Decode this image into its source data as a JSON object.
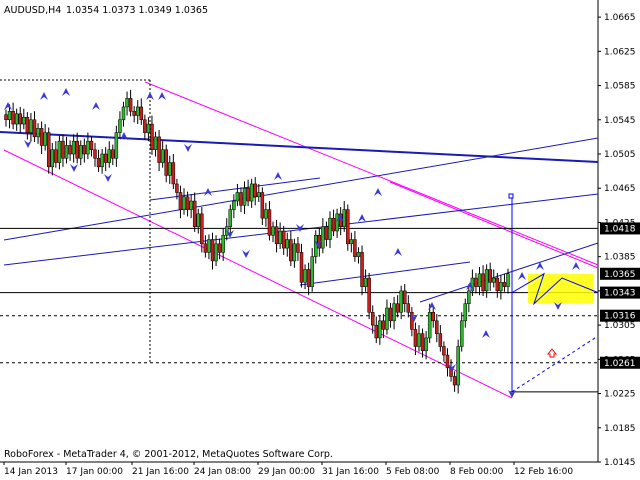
{
  "header": {
    "symbol": "AUDUSD,H4",
    "ohlc": "1.0354 1.0373 1.0349 1.0365"
  },
  "footer": {
    "copyright": "RoboForex - MetaTrader 4, © 2001-2012, MetaQuotes Software Corp."
  },
  "colors": {
    "bull_candle": "#2db52d",
    "bear_candle": "#c81e1e",
    "trend_channel": "#ff00ff",
    "trend_line": "#1a1ab4",
    "fractal_arrow": "#3a3ad0",
    "level_line": "#000000",
    "price_tag_bg": "#000000",
    "price_tag_fg": "#ffffff",
    "forecast_zone": "#ffff00",
    "forecast_arrow": "#ff0000"
  },
  "chart_data": {
    "type": "candlestick",
    "title": "AUDUSD,H4",
    "ylim": [
      1.0145,
      1.0685
    ],
    "price_ticks": [
      "1.0665",
      "1.0625",
      "1.0585",
      "1.0545",
      "1.0505",
      "1.0465",
      "1.0425",
      "1.0385",
      "1.0345",
      "1.0305",
      "1.0265",
      "1.0225",
      "1.0185",
      "1.0145"
    ],
    "time_ticks": [
      "14 Jan 2013",
      "17 Jan 00:00",
      "21 Jan 16:00",
      "24 Jan 08:00",
      "29 Jan 00:00",
      "31 Jan 16:00",
      "5 Feb 08:00",
      "8 Feb 00:00",
      "12 Feb 16:00"
    ],
    "price_tags": [
      {
        "label": "1.0418",
        "highlight": true
      },
      {
        "label": "1.0365",
        "highlight": true
      },
      {
        "label": "1.0343",
        "highlight": true
      },
      {
        "label": "1.0316",
        "highlight": true
      },
      {
        "label": "1.0261",
        "highlight": true
      }
    ],
    "horizontal_levels": [
      1.0418,
      1.0343,
      1.0316,
      1.0261,
      1.0227
    ],
    "closes": [
      1.0545,
      1.0555,
      1.054,
      1.0552,
      1.054,
      1.0548,
      1.053,
      1.0545,
      1.0525,
      1.0535,
      1.0515,
      1.053,
      1.049,
      1.051,
      1.0495,
      1.052,
      1.05,
      1.0515,
      1.0505,
      1.052,
      1.05,
      1.0515,
      1.0505,
      1.052,
      1.051,
      1.05,
      1.049,
      1.0505,
      1.0495,
      1.051,
      1.05,
      1.053,
      1.0545,
      1.056,
      1.057,
      1.0555,
      1.055,
      1.056,
      1.0545,
      1.053,
      1.054,
      1.051,
      1.0525,
      1.0495,
      1.051,
      1.048,
      1.0495,
      1.047,
      1.046,
      1.044,
      1.0455,
      1.044,
      1.045,
      1.042,
      1.0435,
      1.04,
      1.039,
      1.0405,
      1.038,
      1.04,
      1.039,
      1.041,
      1.042,
      1.044,
      1.045,
      1.046,
      1.0445,
      1.0465,
      1.045,
      1.047,
      1.0455,
      1.046,
      1.043,
      1.044,
      1.041,
      1.042,
      1.04,
      1.0415,
      1.0395,
      1.0405,
      1.038,
      1.04,
      1.039,
      1.0355,
      1.037,
      1.035,
      1.0385,
      1.041,
      1.0395,
      1.042,
      1.0405,
      1.043,
      1.0415,
      1.0435,
      1.042,
      1.044,
      1.04,
      1.0405,
      1.0385,
      1.039,
      1.035,
      1.036,
      1.032,
      1.0305,
      1.029,
      1.031,
      1.03,
      1.0325,
      1.031,
      1.033,
      1.032,
      1.0345,
      1.033,
      1.032,
      1.03,
      1.028,
      1.0295,
      1.0275,
      1.029,
      1.032,
      1.031,
      1.0295,
      1.028,
      1.027,
      1.0255,
      1.0245,
      1.0235,
      1.028,
      1.031,
      1.033,
      1.0345,
      1.036,
      1.035,
      1.0365,
      1.0345,
      1.037,
      1.0355,
      1.036,
      1.0345,
      1.0355,
      1.035,
      1.0365
    ],
    "projection_points": [
      1.0227,
      1.0343,
      1.0365,
      1.033,
      1.036,
      1.0343
    ]
  }
}
